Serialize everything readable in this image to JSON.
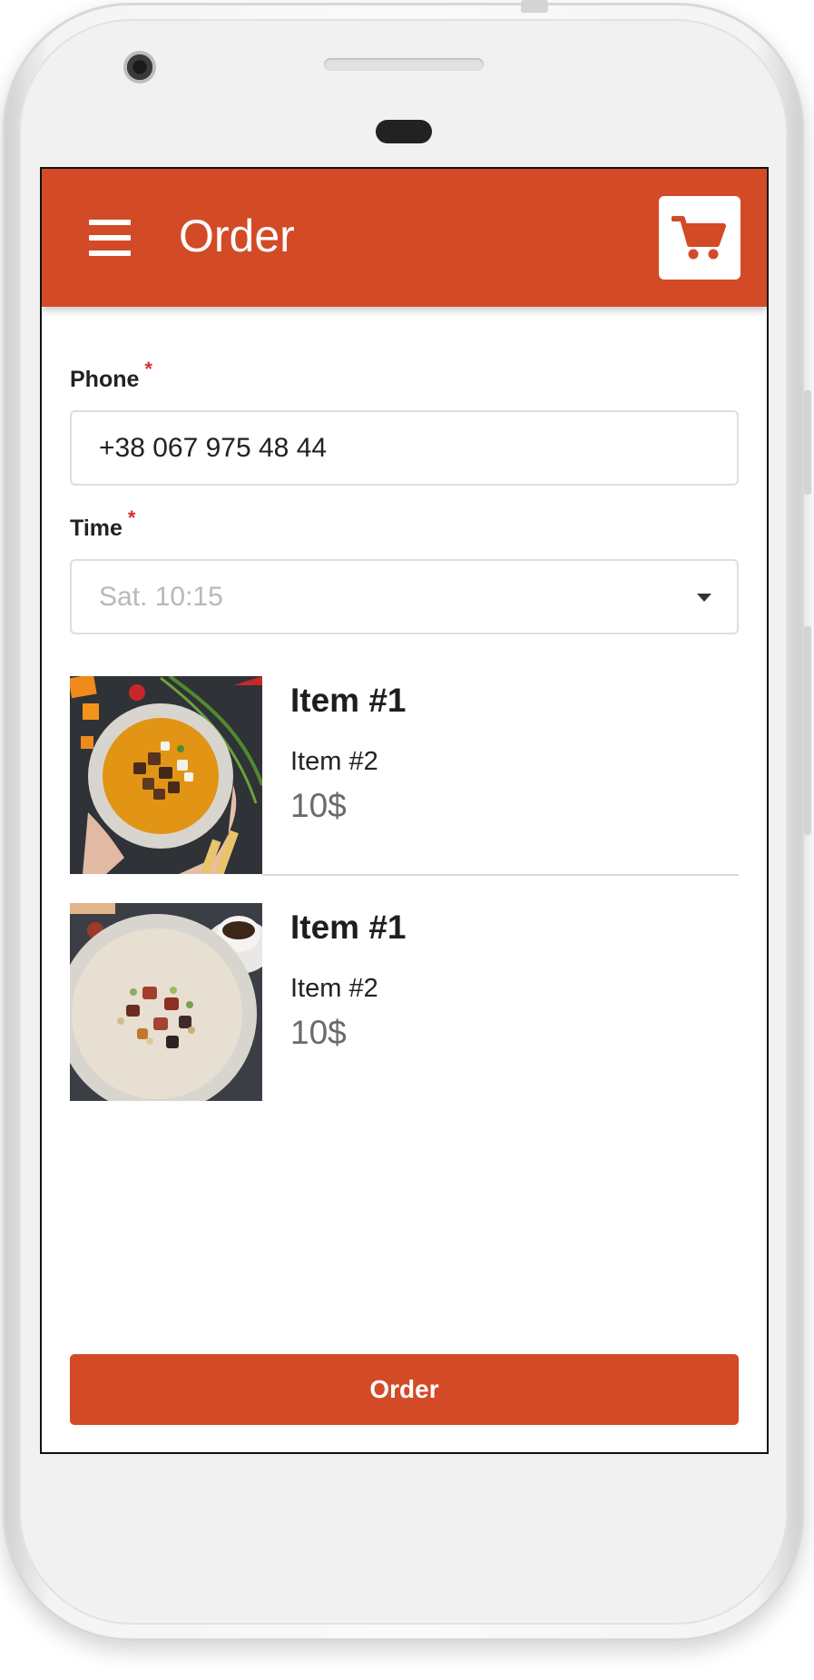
{
  "app": {
    "title": "Order",
    "accent": "#d34a27"
  },
  "header": {
    "menu_icon": "hamburger-menu-icon",
    "cart_icon": "shopping-cart-icon"
  },
  "form": {
    "phone": {
      "label": "Phone",
      "required_mark": "*",
      "value": "+38 067 975 48 44"
    },
    "time": {
      "label": "Time",
      "required_mark": "*",
      "placeholder": "Sat. 10:15"
    }
  },
  "items": [
    {
      "name": "Item #1",
      "subtitle": "Item #2",
      "price": "10$",
      "image": "soup-bowl-photo"
    },
    {
      "name": "Item #1",
      "subtitle": "Item #2",
      "price": "10$",
      "image": "porridge-bowl-photo"
    }
  ],
  "footer": {
    "order_button": "Order"
  }
}
